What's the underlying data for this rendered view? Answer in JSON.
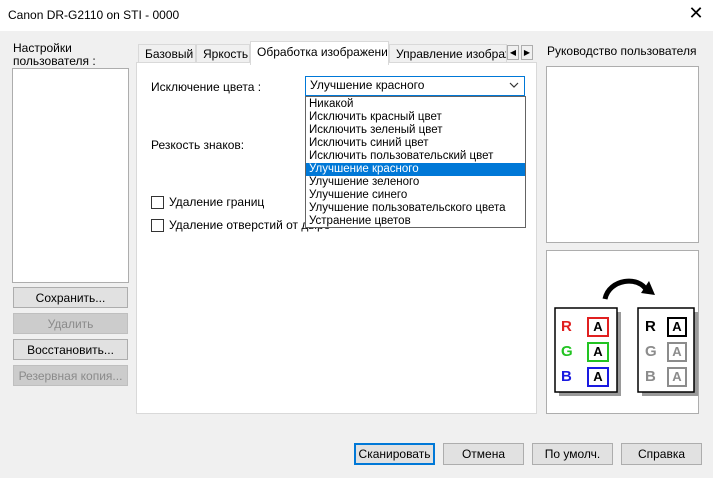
{
  "window": {
    "title": "Canon DR-G2110 on STI - 0000"
  },
  "left": {
    "settings_label": "Настройки\nпользователя :",
    "buttons": {
      "save": "Сохранить...",
      "delete": "Удалить",
      "restore": "Восстановить...",
      "backup": "Резервная копия..."
    }
  },
  "tabs": [
    "Базовый",
    "Яркость",
    "Обработка изображения",
    "Управление изображ"
  ],
  "tab_scroll": {
    "left": "◀",
    "right": "▶"
  },
  "form": {
    "color_dropout_label": "Исключение цвета :",
    "color_dropout_value": "Улучшение красного",
    "sharpness_label": "Резкость знаков:",
    "border_removal_label": "Удаление границ",
    "punch_hole_label": "Удаление отверстий от дыро"
  },
  "dropdown": {
    "options": [
      "Никакой",
      "Исключить красный цвет",
      "Исключить зеленый цвет",
      "Исключить синий цвет",
      "Исключить пользовательский цвет",
      "Улучшение красного",
      "Улучшение зеленого",
      "Улучшение синего",
      "Улучшение пользовательского цвета",
      "Устранение цветов"
    ],
    "selected_index": 5
  },
  "right": {
    "guide_label": "Руководство пользователя"
  },
  "illustration": {
    "left_card": [
      {
        "letter": "R",
        "box": "A",
        "color": "#e02020"
      },
      {
        "letter": "G",
        "box": "A",
        "color": "#22c322"
      },
      {
        "letter": "B",
        "box": "A",
        "color": "#1a1ae0"
      }
    ],
    "right_card": [
      {
        "letter": "R",
        "box": "A",
        "color": "#000000"
      },
      {
        "letter": "G",
        "box": "A",
        "color": "#8c8c8c"
      },
      {
        "letter": "B",
        "box": "A",
        "color": "#8c8c8c"
      }
    ]
  },
  "footer": {
    "scan": "Сканировать",
    "cancel": "Отмена",
    "defaults": "По умолч.",
    "help": "Справка"
  },
  "colors": {
    "accent": "#0078d7",
    "window_bg": "#f0f0f0"
  }
}
